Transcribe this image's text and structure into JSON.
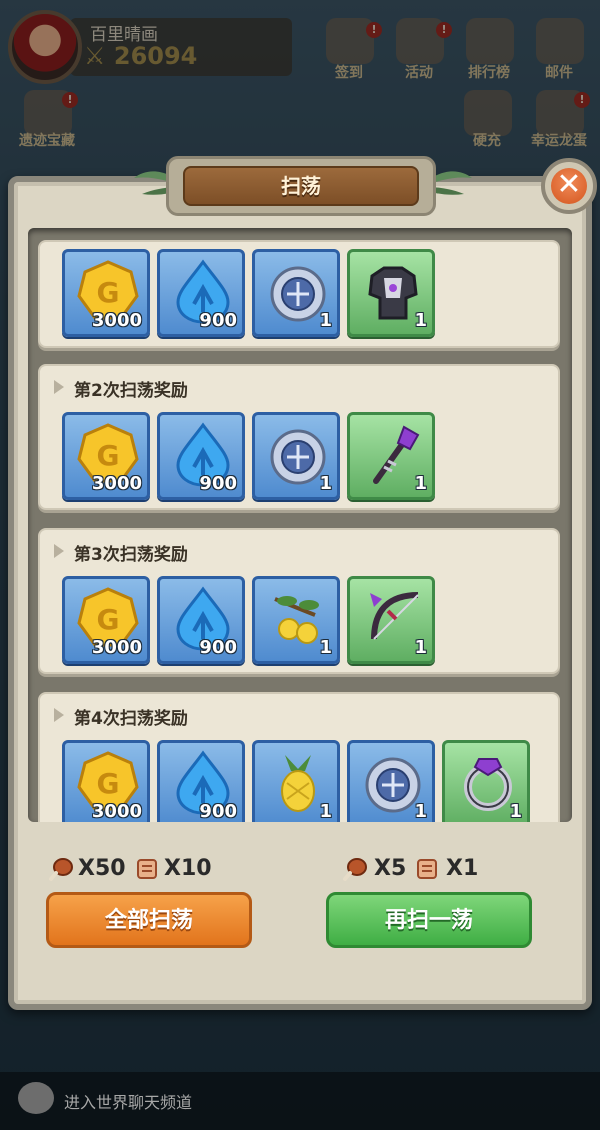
{
  "hud": {
    "player_name": "百里晴画",
    "power": "26094",
    "top_icons": [
      {
        "label": "签到",
        "icon": "sign-in-icon",
        "badge": "!"
      },
      {
        "label": "活动",
        "icon": "activity-icon",
        "badge": "!"
      },
      {
        "label": "排行榜",
        "icon": "leaderboard-icon",
        "badge": ""
      },
      {
        "label": "邮件",
        "icon": "mail-icon",
        "badge": ""
      }
    ],
    "second_row": [
      {
        "label": "遗迹宝藏",
        "icon": "treasure-icon",
        "badge": "!"
      },
      {
        "label": "硬充",
        "icon": "recharge-icon",
        "badge": ""
      },
      {
        "label": "幸运龙蛋",
        "icon": "dragon-egg-icon",
        "badge": "!"
      }
    ]
  },
  "dialog": {
    "title": "扫荡",
    "close": "✕",
    "rounds": [
      {
        "title": "",
        "items": [
          {
            "type": "gold-coin",
            "qty": "3000",
            "rarity": "blue"
          },
          {
            "type": "water-drop",
            "qty": "900",
            "rarity": "blue"
          },
          {
            "type": "rune-stone",
            "qty": "1",
            "rarity": "blue"
          },
          {
            "type": "armor",
            "qty": "1",
            "rarity": "green"
          }
        ]
      },
      {
        "title": "第2次扫荡奖励",
        "items": [
          {
            "type": "gold-coin",
            "qty": "3000",
            "rarity": "blue"
          },
          {
            "type": "water-drop",
            "qty": "900",
            "rarity": "blue"
          },
          {
            "type": "rune-stone",
            "qty": "1",
            "rarity": "blue"
          },
          {
            "type": "staff",
            "qty": "1",
            "rarity": "green"
          }
        ]
      },
      {
        "title": "第3次扫荡奖励",
        "items": [
          {
            "type": "gold-coin",
            "qty": "3000",
            "rarity": "blue"
          },
          {
            "type": "water-drop",
            "qty": "900",
            "rarity": "blue"
          },
          {
            "type": "fruit-branch",
            "qty": "1",
            "rarity": "blue"
          },
          {
            "type": "bow",
            "qty": "1",
            "rarity": "green"
          }
        ]
      },
      {
        "title": "第4次扫荡奖励",
        "items": [
          {
            "type": "gold-coin",
            "qty": "3000",
            "rarity": "blue"
          },
          {
            "type": "water-drop",
            "qty": "900",
            "rarity": "blue"
          },
          {
            "type": "pineapple",
            "qty": "1",
            "rarity": "blue"
          },
          {
            "type": "rune-stone",
            "qty": "1",
            "rarity": "blue"
          },
          {
            "type": "ring",
            "qty": "1",
            "rarity": "green"
          }
        ]
      }
    ],
    "sweep_all": {
      "meat_cost": "X50",
      "scroll_cost": "X10",
      "label": "全部扫荡"
    },
    "sweep_again": {
      "meat_cost": "X5",
      "scroll_cost": "X1",
      "label": "再扫一荡"
    }
  },
  "chat": {
    "placeholder": "进入世界聊天频道"
  },
  "colors": {
    "blue_slot": "#4f8bcf",
    "green_slot": "#5fae62",
    "orange_btn": "#e2741c",
    "green_btn": "#3fae44"
  }
}
